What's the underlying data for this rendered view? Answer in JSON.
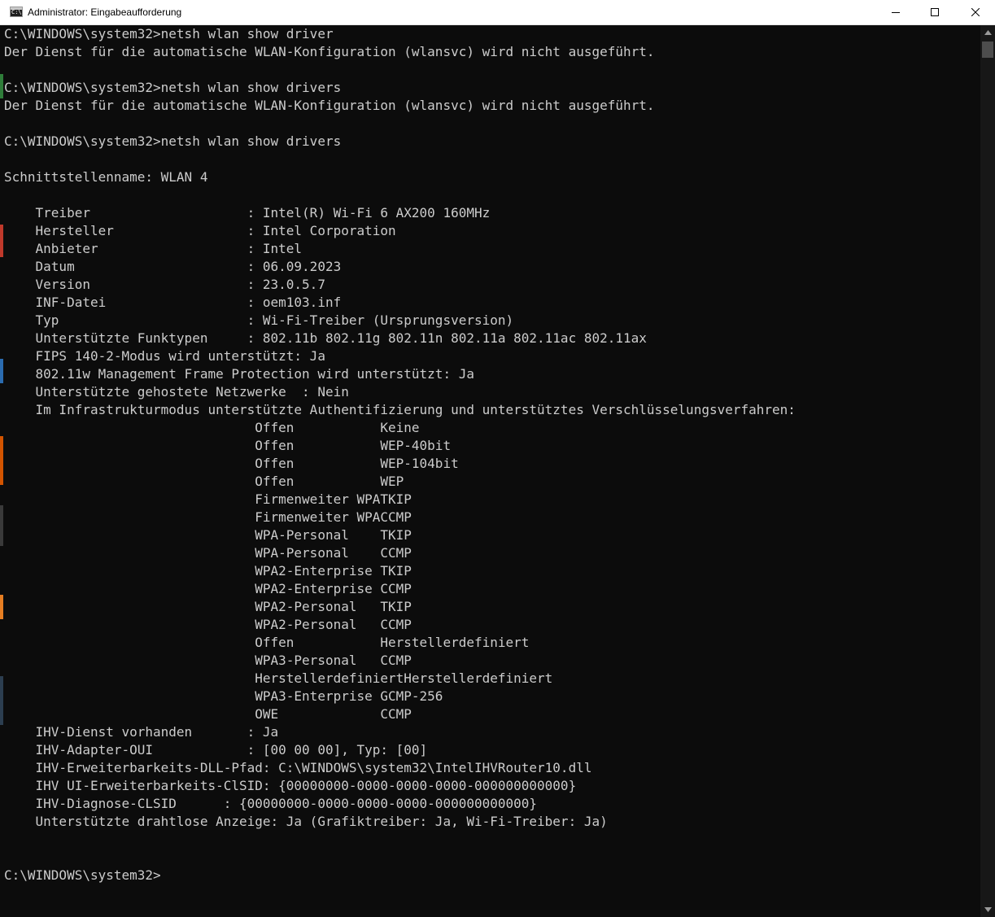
{
  "window": {
    "title": "Administrator: Eingabeaufforderung",
    "icon": "command-prompt-icon"
  },
  "controls": {
    "minimize": "minimize-icon",
    "maximize": "maximize-icon",
    "close": "close-icon"
  },
  "colors": {
    "console_background": "#0c0c0c",
    "console_text": "#cccccc",
    "titlebar_background": "#ffffff"
  },
  "console": {
    "lines": [
      "C:\\WINDOWS\\system32>netsh wlan show driver",
      "Der Dienst für die automatische WLAN-Konfiguration (wlansvc) wird nicht ausgeführt.",
      "",
      "C:\\WINDOWS\\system32>netsh wlan show drivers",
      "Der Dienst für die automatische WLAN-Konfiguration (wlansvc) wird nicht ausgeführt.",
      "",
      "C:\\WINDOWS\\system32>netsh wlan show drivers",
      "",
      "Schnittstellenname: WLAN 4",
      "",
      "    Treiber                    : Intel(R) Wi-Fi 6 AX200 160MHz",
      "    Hersteller                 : Intel Corporation",
      "    Anbieter                   : Intel",
      "    Datum                      : 06.09.2023",
      "    Version                    : 23.0.5.7",
      "    INF-Datei                  : oem103.inf",
      "    Typ                        : Wi-Fi-Treiber (Ursprungsversion)",
      "    Unterstützte Funktypen     : 802.11b 802.11g 802.11n 802.11a 802.11ac 802.11ax",
      "    FIPS 140-2-Modus wird unterstützt: Ja",
      "    802.11w Management Frame Protection wird unterstützt: Ja",
      "    Unterstützte gehostete Netzwerke  : Nein",
      "    Im Infrastrukturmodus unterstützte Authentifizierung und unterstütztes Verschlüsselungsverfahren:",
      "                                Offen           Keine",
      "                                Offen           WEP-40bit",
      "                                Offen           WEP-104bit",
      "                                Offen           WEP",
      "                                Firmenweiter WPATKIP",
      "                                Firmenweiter WPACCMP",
      "                                WPA-Personal    TKIP",
      "                                WPA-Personal    CCMP",
      "                                WPA2-Enterprise TKIP",
      "                                WPA2-Enterprise CCMP",
      "                                WPA2-Personal   TKIP",
      "                                WPA2-Personal   CCMP",
      "                                Offen           Herstellerdefiniert",
      "                                WPA3-Personal   CCMP",
      "                                HerstellerdefiniertHerstellerdefiniert",
      "                                WPA3-Enterprise GCMP-256",
      "                                OWE             CCMP",
      "    IHV-Dienst vorhanden       : Ja",
      "    IHV-Adapter-OUI            : [00 00 00], Typ: [00]",
      "    IHV-Erweiterbarkeits-DLL-Pfad: C:\\WINDOWS\\system32\\IntelIHVRouter10.dll",
      "    IHV UI-Erweiterbarkeits-ClSID: {00000000-0000-0000-0000-000000000000}",
      "    IHV-Diagnose-CLSID      : {00000000-0000-0000-0000-000000000000}",
      "    Unterstützte drahtlose Anzeige: Ja (Grafiktreiber: Ja, Wi-Fi-Treiber: Ja)",
      "",
      "",
      "C:\\WINDOWS\\system32>"
    ]
  },
  "scrollbar": {
    "up": "scroll-up-arrow-icon",
    "down": "scroll-down-arrow-icon"
  }
}
